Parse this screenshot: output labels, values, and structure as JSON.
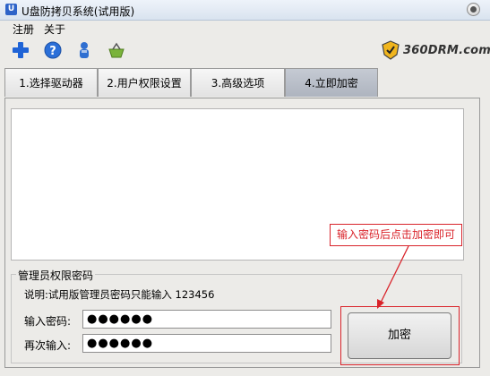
{
  "window": {
    "title": "U盘防拷贝系统(试用版)",
    "app_icon_glyph": "U"
  },
  "menu": {
    "items": [
      {
        "label": "注册"
      },
      {
        "label": "关于"
      }
    ]
  },
  "toolbar": {
    "icons": [
      "add-icon",
      "help-icon",
      "user-icon",
      "basket-icon"
    ]
  },
  "brand": {
    "text": "360DRM.com"
  },
  "tabs": [
    {
      "label": "1.选择驱动器"
    },
    {
      "label": "2.用户权限设置"
    },
    {
      "label": "3.高级选项"
    },
    {
      "label": "4.立即加密",
      "active": true
    }
  ],
  "content": {
    "log_text": ""
  },
  "admin_group": {
    "title": "管理员权限密码",
    "note": "说明:试用版管理员密码只能输入 123456",
    "password_label": "输入密码:",
    "password_value": "●●●●●●",
    "confirm_label": "再次输入:",
    "confirm_value": "●●●●●●",
    "encrypt_button": "加密"
  },
  "annotation": {
    "callout_text": "输入密码后点击加密即可",
    "color": "#d9232a"
  },
  "colors": {
    "accent_red": "#d9232a",
    "active_tab": "#b4bac4"
  }
}
